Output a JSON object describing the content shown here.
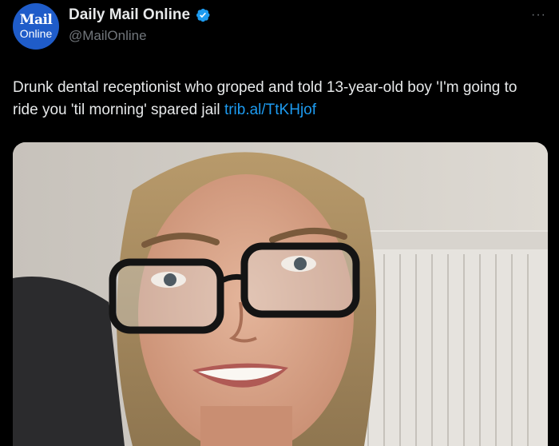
{
  "account": {
    "avatar_line1": "Mail",
    "avatar_line2": "Online",
    "display_name": "Daily Mail Online",
    "handle": "@MailOnline"
  },
  "menu": {
    "more_label": "···"
  },
  "tweet": {
    "text": "Drunk dental receptionist who groped and told 13-year-old boy 'I'm going to ride you 'til morning' spared jail ",
    "link": "trib.al/TtKHjof"
  },
  "colors": {
    "background": "#000000",
    "text": "#e7e9ea",
    "secondary_text": "#71767b",
    "link": "#1d9bf0",
    "avatar": "#1f5cc9",
    "verified_badge": "#1d9bf0"
  }
}
